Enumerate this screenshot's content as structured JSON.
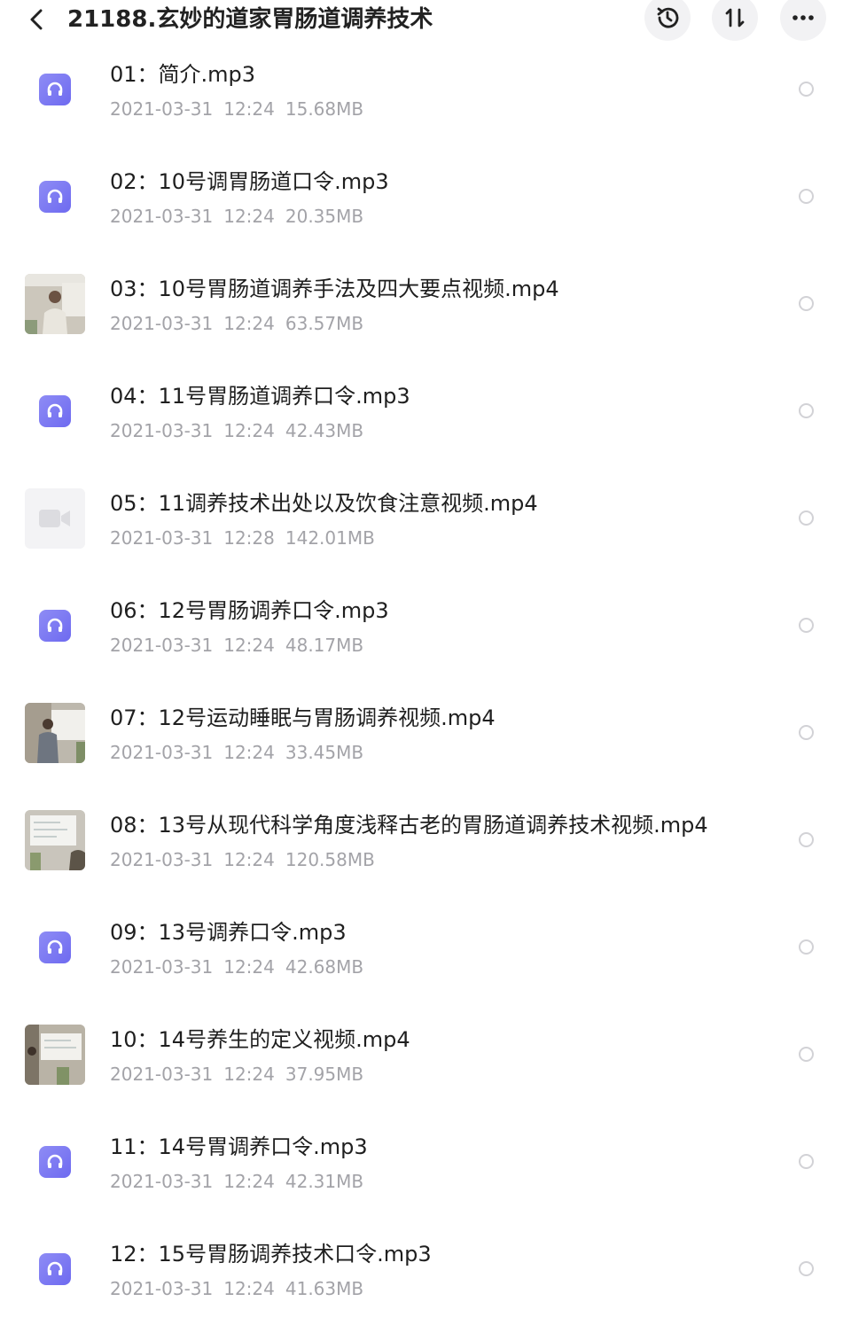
{
  "header": {
    "title": "21188.玄妙的道家胃肠道调养技术",
    "back_icon": "chevron-left-icon",
    "actions": [
      {
        "name": "history-button",
        "icon": "history-icon"
      },
      {
        "name": "sort-button",
        "icon": "sort-icon"
      },
      {
        "name": "more-button",
        "icon": "more-dots-icon"
      }
    ]
  },
  "files": [
    {
      "name": "01：简介.mp3",
      "date": "2021-03-31",
      "time": "12:24",
      "size": "15.68MB",
      "kind": "audio"
    },
    {
      "name": "02：10号调胃肠道口令.mp3",
      "date": "2021-03-31",
      "time": "12:24",
      "size": "20.35MB",
      "kind": "audio"
    },
    {
      "name": "03：10号胃肠道调养手法及四大要点视频.mp4",
      "date": "2021-03-31",
      "time": "12:24",
      "size": "63.57MB",
      "kind": "video-thumb"
    },
    {
      "name": "04：11号胃肠道调养口令.mp3",
      "date": "2021-03-31",
      "time": "12:24",
      "size": "42.43MB",
      "kind": "audio"
    },
    {
      "name": "05：11调养技术出处以及饮食注意视频.mp4",
      "date": "2021-03-31",
      "time": "12:28",
      "size": "142.01MB",
      "kind": "video-placeholder"
    },
    {
      "name": "06：12号胃肠调养口令.mp3",
      "date": "2021-03-31",
      "time": "12:24",
      "size": "48.17MB",
      "kind": "audio"
    },
    {
      "name": "07：12号运动睡眠与胃肠调养视频.mp4",
      "date": "2021-03-31",
      "time": "12:24",
      "size": "33.45MB",
      "kind": "video-thumb"
    },
    {
      "name": "08：13号从现代科学角度浅释古老的胃肠道调养技术视频.mp4",
      "date": "2021-03-31",
      "time": "12:24",
      "size": "120.58MB",
      "kind": "video-thumb"
    },
    {
      "name": "09：13号调养口令.mp3",
      "date": "2021-03-31",
      "time": "12:24",
      "size": "42.68MB",
      "kind": "audio"
    },
    {
      "name": "10：14号养生的定义视频.mp4",
      "date": "2021-03-31",
      "time": "12:24",
      "size": "37.95MB",
      "kind": "video-thumb"
    },
    {
      "name": "11：14号胃调养口令.mp3",
      "date": "2021-03-31",
      "time": "12:24",
      "size": "42.31MB",
      "kind": "audio"
    },
    {
      "name": "12：15号胃肠调养技术口令.mp3",
      "date": "2021-03-31",
      "time": "12:24",
      "size": "41.63MB",
      "kind": "audio"
    }
  ],
  "colors": {
    "audio_badge": "#7b78f2",
    "meta_text": "#a3a3a8",
    "radio_border": "#d2d2d6",
    "header_button_bg": "#f2f2f4"
  }
}
